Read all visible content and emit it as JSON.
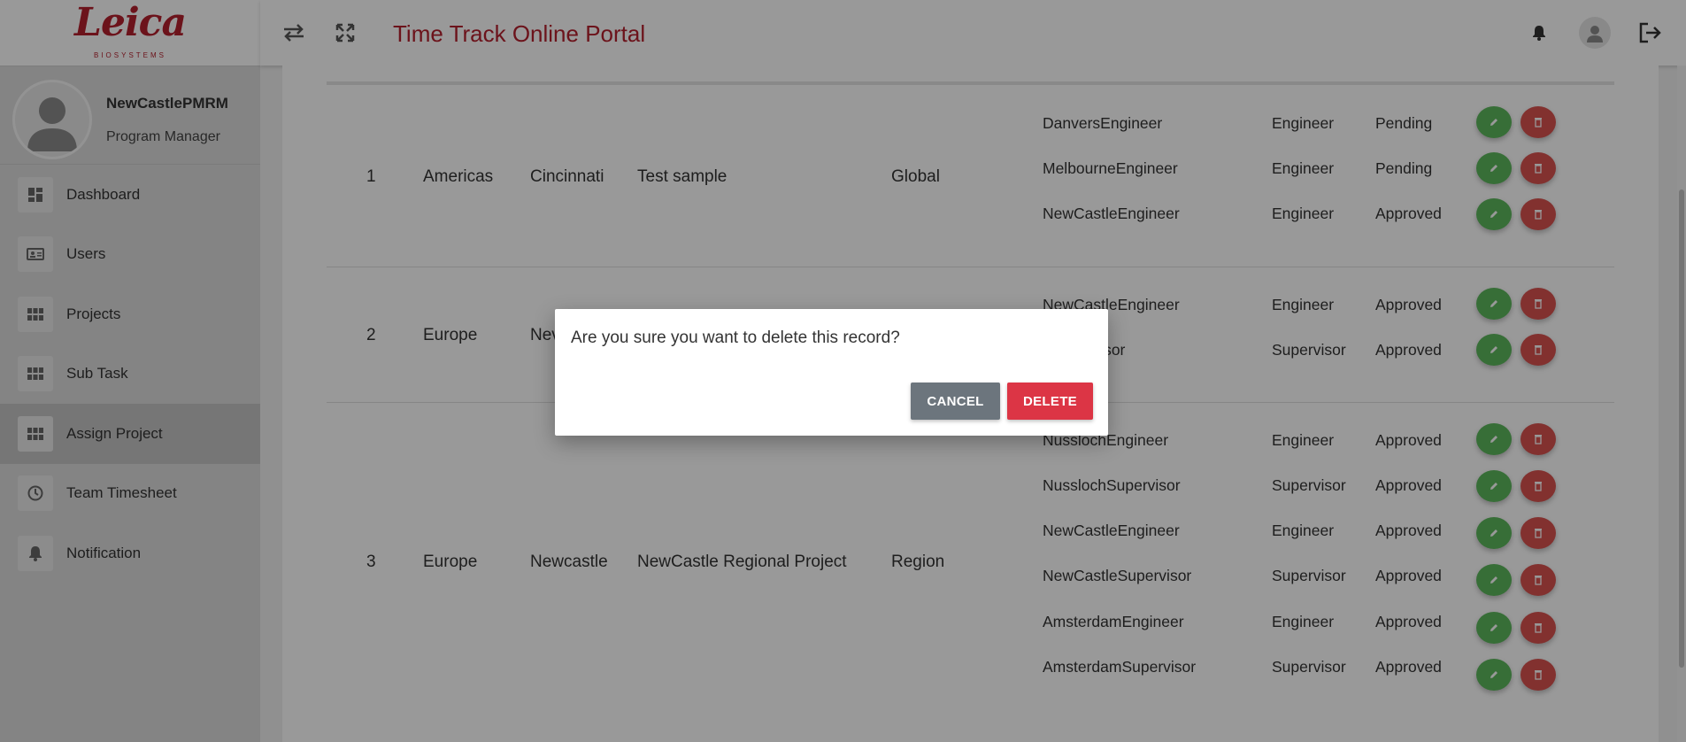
{
  "logo": {
    "word": "Leica",
    "sub": "BIOSYSTEMS"
  },
  "header": {
    "title": "Time Track Online Portal"
  },
  "profile": {
    "name": "NewCastlePMRM",
    "role": "Program Manager"
  },
  "sidebar": {
    "items": [
      {
        "label": "Dashboard",
        "icon": "dashboard-icon"
      },
      {
        "label": "Users",
        "icon": "id-card-icon"
      },
      {
        "label": "Projects",
        "icon": "grid-icon"
      },
      {
        "label": "Sub Task",
        "icon": "grid-icon"
      },
      {
        "label": "Assign Project",
        "icon": "grid-icon",
        "active": true
      },
      {
        "label": "Team Timesheet",
        "icon": "clock-icon"
      },
      {
        "label": "Notification",
        "icon": "bell-icon"
      }
    ]
  },
  "projects": [
    {
      "no": "1",
      "region": "Americas",
      "site": "Cincinnati",
      "project": "Test sample",
      "scope": "Global",
      "assignees": [
        {
          "user": "DanversEngineer",
          "role": "Engineer",
          "status": "Pending"
        },
        {
          "user": "MelbourneEngineer",
          "role": "Engineer",
          "status": "Pending"
        },
        {
          "user": "NewCastleEngineer",
          "role": "Engineer",
          "status": "Approved"
        }
      ]
    },
    {
      "no": "2",
      "region": "Europe",
      "site": "Nev",
      "project": "",
      "scope": "",
      "assignees": [
        {
          "user": "NewCastleEngineer",
          "role": "Engineer",
          "status": "Approved"
        },
        {
          "user": "eSupervisor",
          "role": "Supervisor",
          "status": "Approved"
        }
      ]
    },
    {
      "no": "3",
      "region": "Europe",
      "site": "Newcastle",
      "project": "NewCastle Regional Project",
      "scope": "Region",
      "assignees": [
        {
          "user": "NusslochEngineer",
          "role": "Engineer",
          "status": "Approved"
        },
        {
          "user": "NusslochSupervisor",
          "role": "Supervisor",
          "status": "Approved"
        },
        {
          "user": "NewCastleEngineer",
          "role": "Engineer",
          "status": "Approved"
        },
        {
          "user": "NewCastleSupervisor",
          "role": "Supervisor",
          "status": "Approved"
        },
        {
          "user": "AmsterdamEngineer",
          "role": "Engineer",
          "status": "Approved"
        },
        {
          "user": "AmsterdamSupervisor",
          "role": "Supervisor",
          "status": "Approved"
        }
      ]
    }
  ],
  "modal": {
    "message": "Are you sure you want to delete this record?",
    "cancel_label": "CANCEL",
    "delete_label": "DELETE"
  },
  "colors": {
    "brand": "#b5202e",
    "edit": "#5cb85c",
    "delete": "#d9534f",
    "cancel": "#6c757d"
  }
}
